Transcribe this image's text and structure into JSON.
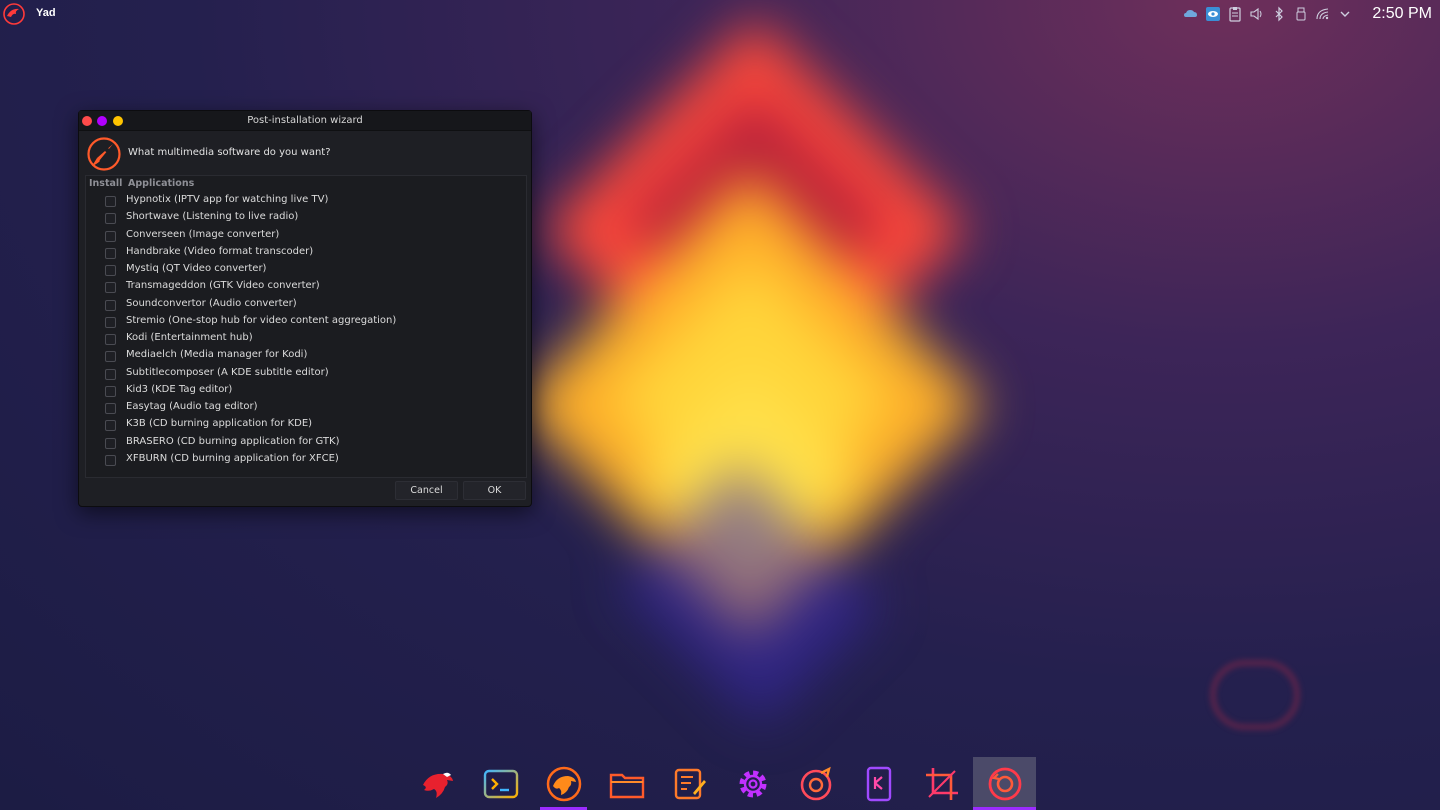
{
  "topbar": {
    "app_name": "Yad",
    "clock": "2:50 PM",
    "tray_icons": [
      "cloud-icon",
      "vision-icon",
      "clipboard-icon",
      "volume-icon",
      "bluetooth-icon",
      "usb-icon",
      "wifi-icon",
      "chevron-down-icon"
    ]
  },
  "dialog": {
    "title": "Post-installation wizard",
    "question": "What multimedia software do you want?",
    "columns": {
      "install": "Install",
      "applications": "Applications"
    },
    "items": [
      "Hypnotix (IPTV app for watching live TV)",
      "Shortwave (Listening to live radio)",
      "Converseen (Image converter)",
      "Handbrake (Video format transcoder)",
      "Mystiq (QT Video converter)",
      "Transmageddon (GTK Video converter)",
      "Soundconvertor (Audio converter)",
      "Stremio (One-stop hub for video content aggregation)",
      "Kodi (Entertainment hub)",
      "Mediaelch (Media manager for Kodi)",
      "Subtitlecomposer (A KDE subtitle editor)",
      "Kid3 (KDE Tag editor)",
      "Easytag (Audio tag editor)",
      "K3B (CD burning application for KDE)",
      "BRASERO (CD burning application for GTK)",
      "XFBURN (CD burning application for XFCE)"
    ],
    "cancel_label": "Cancel",
    "ok_label": "OK"
  },
  "dock": {
    "items": [
      "garuda-icon",
      "terminal-icon",
      "garuda-welcome-icon",
      "folder-icon",
      "text-editor-icon",
      "settings-icon",
      "disc-burner-icon",
      "kdeconnect-icon",
      "crop-icon",
      "timeshift-icon"
    ]
  },
  "colors": {
    "accent": "#ff5a2a",
    "running_indicator": "#9b2cff",
    "close": "#ff4b4b",
    "maximize": "#b100ff",
    "minimize": "#ffc400"
  }
}
